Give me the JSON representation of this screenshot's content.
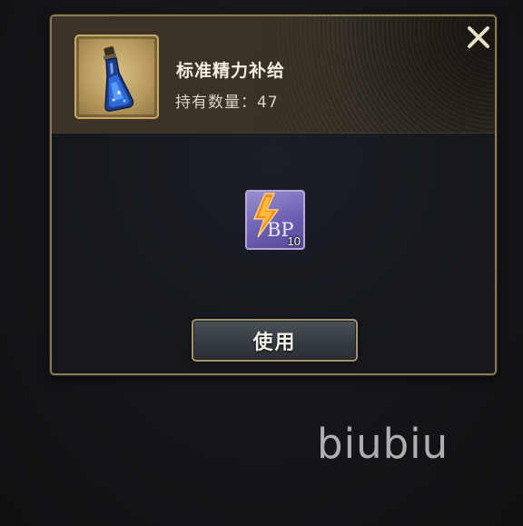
{
  "item": {
    "name": "标准精力补给",
    "quantity_label": "持有数量：47",
    "icon": "blue-potion-bottle-icon"
  },
  "reward": {
    "icon": "bp-lightning-icon",
    "symbol": "BP",
    "count": "10"
  },
  "actions": {
    "use_label": "使用",
    "close_icon": "close-x-icon"
  },
  "watermark": "biubiu",
  "colors": {
    "frame_gold": "#c9a865",
    "border_gold": "#8a7a55",
    "bp_purple": "#6d5fb3",
    "lightning_orange": "#f08a1c"
  }
}
